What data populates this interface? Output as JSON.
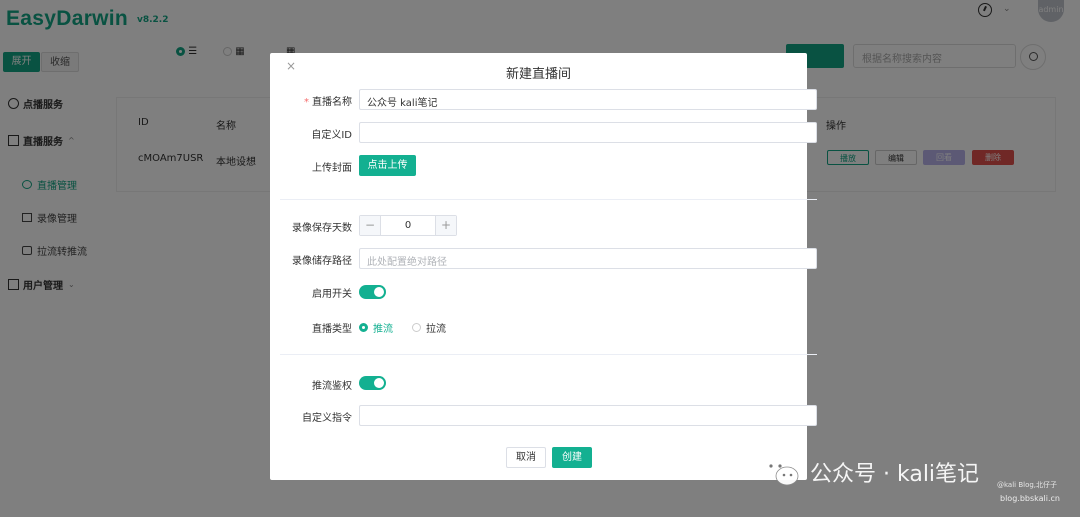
{
  "app": {
    "logo": "EasyDarwin",
    "version": "v8.2.2",
    "avatar_text": "admin"
  },
  "sidebar": {
    "expand_label": "展开",
    "collapse_label": "收缩",
    "items": [
      {
        "label": "点播服务"
      },
      {
        "label": "直播服务"
      },
      {
        "label": "直播管理"
      },
      {
        "label": "录像管理"
      },
      {
        "label": "拉流转推流"
      },
      {
        "label": "用户管理"
      }
    ]
  },
  "toolbar": {
    "search_placeholder": "根据名称搜索内容"
  },
  "table": {
    "headers": {
      "id": "ID",
      "name": "名称",
      "actions": "操作"
    },
    "rows": [
      {
        "id": "cMOAm7USR",
        "name": "本地设想"
      }
    ],
    "action_labels": {
      "play": "播放",
      "edit": "编辑",
      "snapshot": "回看",
      "delete": "删除"
    }
  },
  "modal": {
    "title": "新建直播间",
    "close": "×",
    "fields": {
      "name_label": "直播名称",
      "name_value": "公众号 kali笔记",
      "custom_id_label": "自定义ID",
      "custom_id_value": "",
      "cover_label": "上传封面",
      "upload_button": "点击上传",
      "retention_label": "录像保存天数",
      "retention_value": "0",
      "storage_label": "录像储存路径",
      "storage_placeholder": "此处配置绝对路径",
      "enable_label": "启用开关",
      "enable_on": true,
      "type_label": "直播类型",
      "type_push": "推流",
      "type_pull": "拉流",
      "type_selected": "推流",
      "auth_label": "推流鉴权",
      "auth_on": true,
      "cmd_label": "自定义指令",
      "cmd_value": ""
    },
    "cancel_button": "取消",
    "create_button": "创建"
  },
  "watermark": {
    "main": "公众号 · kali笔记",
    "blog": "@kali Blog,北仔子",
    "url": "blog.bbskali.cn"
  },
  "colors": {
    "accent": "#13a584",
    "danger": "#f56c6c",
    "overlay": "rgba(0,0,0,0.5)"
  }
}
